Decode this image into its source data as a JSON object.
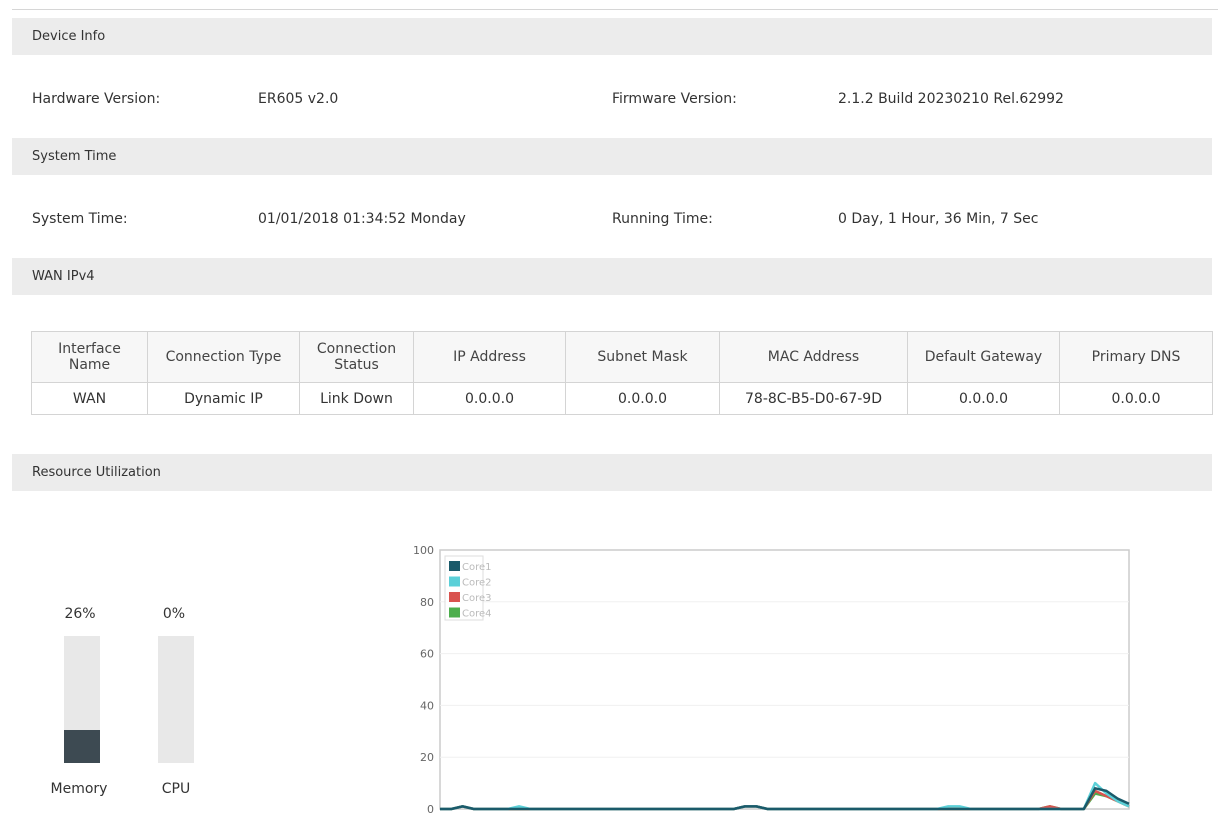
{
  "device_info": {
    "header": "Device Info",
    "hardware_label": "Hardware Version:",
    "hardware_value": "ER605 v2.0",
    "firmware_label": "Firmware Version:",
    "firmware_value": "2.1.2 Build 20230210 Rel.62992"
  },
  "system_time": {
    "header": "System Time",
    "time_label": "System Time:",
    "time_value": "01/01/2018 01:34:52 Monday",
    "running_label": "Running Time:",
    "running_value": "0 Day, 1 Hour, 36 Min, 7 Sec"
  },
  "wan": {
    "header": "WAN IPv4",
    "columns": [
      "Interface Name",
      "Connection Type",
      "Connection Status",
      "IP Address",
      "Subnet Mask",
      "MAC Address",
      "Default Gateway",
      "Primary DNS"
    ],
    "rows": [
      [
        "WAN",
        "Dynamic IP",
        "Link Down",
        "0.0.0.0",
        "0.0.0.0",
        "78-8C-B5-D0-67-9D",
        "0.0.0.0",
        "0.0.0.0"
      ]
    ]
  },
  "resource": {
    "header": "Resource Utilization",
    "memory": {
      "label": "Memory",
      "percent_text": "26%",
      "value": 26
    },
    "cpu": {
      "label": "CPU",
      "percent_text": "0%",
      "value": 0
    }
  },
  "colors": {
    "core1": "#1a5a6a",
    "core2": "#5bd0d8",
    "core3": "#d9534f",
    "core4": "#4cae4c",
    "memory_fill": "#3d4a52"
  },
  "chart_data": {
    "type": "line",
    "y_ticks": [
      "0",
      "20",
      "40",
      "60",
      "80",
      "100"
    ],
    "ylim": [
      0,
      100
    ],
    "legend": [
      "Core1",
      "Core2",
      "Core3",
      "Core4"
    ],
    "series": [
      {
        "name": "Core1",
        "values": [
          0,
          0,
          1,
          0,
          0,
          0,
          0,
          0,
          0,
          0,
          0,
          0,
          0,
          0,
          0,
          0,
          0,
          0,
          0,
          0,
          0,
          0,
          0,
          0,
          0,
          0,
          0,
          1,
          1,
          0,
          0,
          0,
          0,
          0,
          0,
          0,
          0,
          0,
          0,
          0,
          0,
          0,
          0,
          0,
          0,
          0,
          0,
          0,
          0,
          0,
          0,
          0,
          0,
          0,
          0,
          0,
          0,
          0,
          8,
          7,
          4,
          2
        ]
      },
      {
        "name": "Core2",
        "values": [
          0,
          0,
          1,
          0,
          0,
          0,
          0,
          1,
          0,
          0,
          0,
          0,
          0,
          0,
          0,
          0,
          0,
          0,
          0,
          0,
          0,
          0,
          0,
          0,
          0,
          0,
          0,
          1,
          1,
          0,
          0,
          0,
          0,
          0,
          0,
          0,
          0,
          0,
          0,
          0,
          0,
          0,
          0,
          0,
          0,
          1,
          1,
          0,
          0,
          0,
          0,
          0,
          0,
          0,
          0,
          0,
          0,
          0,
          10,
          6,
          3,
          1
        ]
      },
      {
        "name": "Core3",
        "values": [
          0,
          0,
          1,
          0,
          0,
          0,
          0,
          0,
          0,
          0,
          0,
          0,
          0,
          0,
          0,
          0,
          0,
          0,
          0,
          0,
          0,
          0,
          0,
          0,
          0,
          0,
          0,
          1,
          1,
          0,
          0,
          0,
          0,
          0,
          0,
          0,
          0,
          0,
          0,
          0,
          0,
          0,
          0,
          0,
          0,
          0,
          0,
          0,
          0,
          0,
          0,
          0,
          0,
          0,
          1,
          0,
          0,
          0,
          7,
          5,
          3,
          1
        ]
      },
      {
        "name": "Core4",
        "values": [
          0,
          0,
          1,
          0,
          0,
          0,
          0,
          0,
          0,
          0,
          0,
          0,
          0,
          0,
          0,
          0,
          0,
          0,
          0,
          0,
          0,
          0,
          0,
          0,
          0,
          0,
          0,
          1,
          1,
          0,
          0,
          0,
          0,
          0,
          0,
          0,
          0,
          0,
          0,
          0,
          0,
          0,
          0,
          0,
          0,
          0,
          0,
          0,
          0,
          0,
          0,
          0,
          0,
          0,
          1,
          0,
          0,
          0,
          6,
          5,
          3,
          1
        ]
      }
    ]
  }
}
